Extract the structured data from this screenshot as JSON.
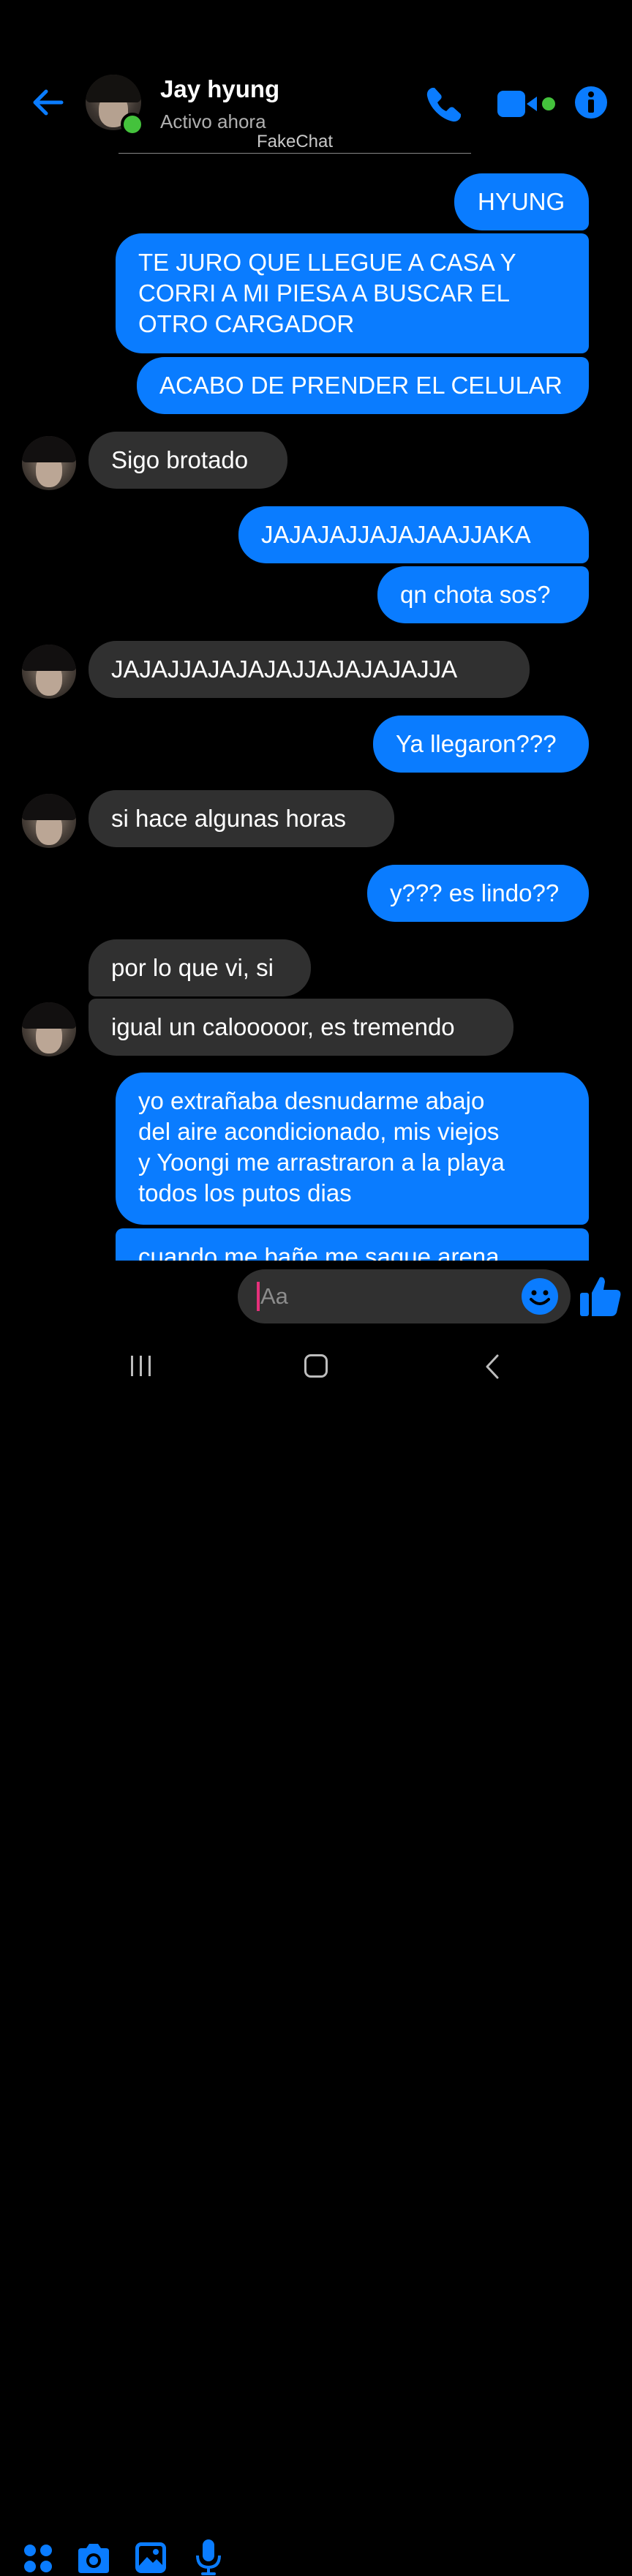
{
  "header": {
    "contact_name": "Jay hyung",
    "status": "Activo ahora",
    "watermark": "FakeChat",
    "icons": [
      "back-arrow-icon",
      "phone-icon",
      "video-camera-icon",
      "info-icon"
    ]
  },
  "colors": {
    "accent": "#0a7cff",
    "incoming_bubble": "#303030",
    "background": "#000000",
    "online": "#44c23c"
  },
  "messages": [
    {
      "dir": "out",
      "text": "HYUNG"
    },
    {
      "dir": "out",
      "text": "TE JURO QUE LLEGUE A CASA Y\nCORRI A MI PIESA A BUSCAR EL\nOTRO CARGADOR"
    },
    {
      "dir": "out",
      "text": "ACABO DE PRENDER EL CELULAR"
    },
    {
      "dir": "in",
      "text": "Sigo brotado"
    },
    {
      "dir": "out",
      "text": "JAJAJAJJAJAJAAJJAKA"
    },
    {
      "dir": "out",
      "text": "qn chota sos?"
    },
    {
      "dir": "in",
      "text": "JAJAJJAJAJAJAJJAJAJAJAJJA"
    },
    {
      "dir": "out",
      "text": "Ya llegaron???"
    },
    {
      "dir": "in",
      "text": "si hace algunas horas"
    },
    {
      "dir": "out",
      "text": "y??? es lindo??"
    },
    {
      "dir": "in",
      "text": "por lo que vi, si"
    },
    {
      "dir": "in",
      "text": "igual un calooooor, es tremendo"
    },
    {
      "dir": "out",
      "text": "yo extrañaba desnudarme abajo\ndel aire acondicionado, mis viejos\ny Yoongi me arrastraron a la playa\ntodos los putos dias"
    },
    {
      "dir": "out",
      "text": "cuando me bañe me saque arena"
    }
  ],
  "composer": {
    "placeholder": "Aa",
    "icons": [
      "apps-icon",
      "camera-icon",
      "gallery-icon",
      "microphone-icon",
      "emoji-icon",
      "thumbs-up-icon"
    ]
  },
  "navbar": {
    "icons": [
      "recent-apps-icon",
      "home-icon",
      "back-icon"
    ]
  }
}
